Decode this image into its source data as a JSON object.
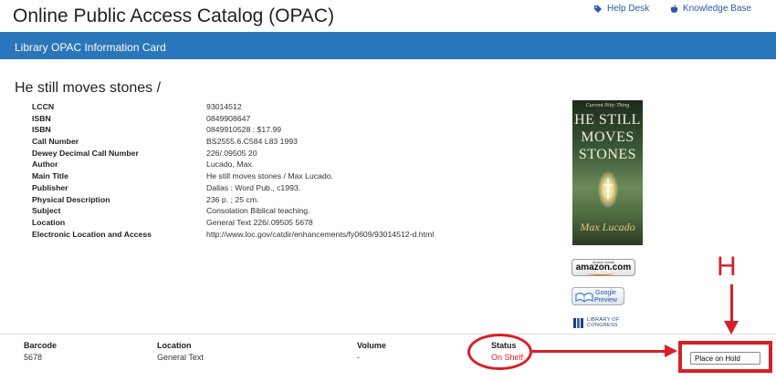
{
  "header": {
    "title": "Online Public Access Catalog (OPAC)",
    "links": {
      "help_desk": "Help Desk",
      "knowledge_base": "Knowledge Base"
    }
  },
  "banner": {
    "title": "Library OPAC Information Card"
  },
  "record": {
    "title": "He still moves stones /",
    "fields": [
      {
        "label": "LCCN",
        "value": "93014512"
      },
      {
        "label": "ISBN",
        "value": "0849908647"
      },
      {
        "label": "ISBN",
        "value": "0849910528 : $17.99"
      },
      {
        "label": "Call Number",
        "value": "BS2555.6.C584 L83 1993"
      },
      {
        "label": "Dewey Decimal Call Number",
        "value": "226/.09505 20"
      },
      {
        "label": "Author",
        "value": "Lucado, Max."
      },
      {
        "label": "Main Title",
        "value": "He still moves stones / Max Lucado."
      },
      {
        "label": "Publisher",
        "value": "Dallas : Word Pub., c1993."
      },
      {
        "label": "Physical Description",
        "value": "236 p. ; 25 cm."
      },
      {
        "label": "Subject",
        "value": "Consolation Biblical teaching."
      },
      {
        "label": "Location",
        "value": "General Text 226/.09505 5678"
      },
      {
        "label": "Electronic Location and Access",
        "value": "http://www.loc.gov/catdir/enhancements/fy0609/93014512-d.html"
      }
    ]
  },
  "cover": {
    "author_top": "Current Nitty Thing",
    "title_lines": [
      "HE STILL",
      "MOVES",
      "STONES"
    ],
    "author_bottom": "Max Lucado"
  },
  "badges": {
    "amazon_small": "Search Inside",
    "amazon": "amazon.com",
    "google": "Google\nPreview",
    "loc": "LIBRARY OF\nCONGRESS"
  },
  "holdings": {
    "headers": {
      "barcode": "Barcode",
      "location": "Location",
      "volume": "Volume",
      "status": "Status"
    },
    "row": {
      "barcode": "5678",
      "location": "General Text",
      "volume": "-",
      "status": "On Shelf"
    }
  },
  "annotation": {
    "label": "H"
  },
  "actions": {
    "place_on_hold": "Place on Hold"
  },
  "colors": {
    "banner": "#2a76bb",
    "link": "#2a5aa8",
    "annotation": "#d91f26",
    "on_shelf": "#e02020"
  }
}
